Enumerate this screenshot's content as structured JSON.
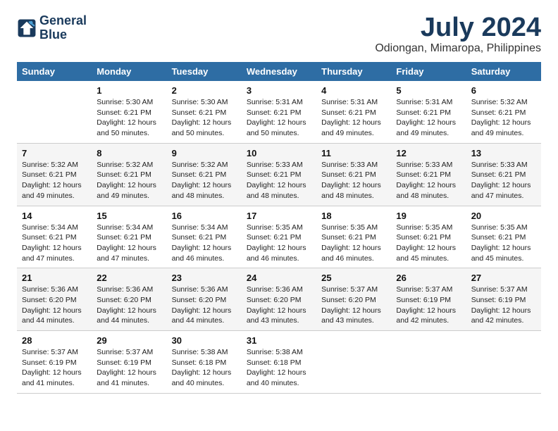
{
  "header": {
    "logo_line1": "General",
    "logo_line2": "Blue",
    "month": "July 2024",
    "location": "Odiongan, Mimaropa, Philippines"
  },
  "days_of_week": [
    "Sunday",
    "Monday",
    "Tuesday",
    "Wednesday",
    "Thursday",
    "Friday",
    "Saturday"
  ],
  "weeks": [
    [
      {
        "day": "",
        "sunrise": "",
        "sunset": "",
        "daylight": ""
      },
      {
        "day": "1",
        "sunrise": "Sunrise: 5:30 AM",
        "sunset": "Sunset: 6:21 PM",
        "daylight": "Daylight: 12 hours and 50 minutes."
      },
      {
        "day": "2",
        "sunrise": "Sunrise: 5:30 AM",
        "sunset": "Sunset: 6:21 PM",
        "daylight": "Daylight: 12 hours and 50 minutes."
      },
      {
        "day": "3",
        "sunrise": "Sunrise: 5:31 AM",
        "sunset": "Sunset: 6:21 PM",
        "daylight": "Daylight: 12 hours and 50 minutes."
      },
      {
        "day": "4",
        "sunrise": "Sunrise: 5:31 AM",
        "sunset": "Sunset: 6:21 PM",
        "daylight": "Daylight: 12 hours and 49 minutes."
      },
      {
        "day": "5",
        "sunrise": "Sunrise: 5:31 AM",
        "sunset": "Sunset: 6:21 PM",
        "daylight": "Daylight: 12 hours and 49 minutes."
      },
      {
        "day": "6",
        "sunrise": "Sunrise: 5:32 AM",
        "sunset": "Sunset: 6:21 PM",
        "daylight": "Daylight: 12 hours and 49 minutes."
      }
    ],
    [
      {
        "day": "7",
        "sunrise": "Sunrise: 5:32 AM",
        "sunset": "Sunset: 6:21 PM",
        "daylight": "Daylight: 12 hours and 49 minutes."
      },
      {
        "day": "8",
        "sunrise": "Sunrise: 5:32 AM",
        "sunset": "Sunset: 6:21 PM",
        "daylight": "Daylight: 12 hours and 49 minutes."
      },
      {
        "day": "9",
        "sunrise": "Sunrise: 5:32 AM",
        "sunset": "Sunset: 6:21 PM",
        "daylight": "Daylight: 12 hours and 48 minutes."
      },
      {
        "day": "10",
        "sunrise": "Sunrise: 5:33 AM",
        "sunset": "Sunset: 6:21 PM",
        "daylight": "Daylight: 12 hours and 48 minutes."
      },
      {
        "day": "11",
        "sunrise": "Sunrise: 5:33 AM",
        "sunset": "Sunset: 6:21 PM",
        "daylight": "Daylight: 12 hours and 48 minutes."
      },
      {
        "day": "12",
        "sunrise": "Sunrise: 5:33 AM",
        "sunset": "Sunset: 6:21 PM",
        "daylight": "Daylight: 12 hours and 48 minutes."
      },
      {
        "day": "13",
        "sunrise": "Sunrise: 5:33 AM",
        "sunset": "Sunset: 6:21 PM",
        "daylight": "Daylight: 12 hours and 47 minutes."
      }
    ],
    [
      {
        "day": "14",
        "sunrise": "Sunrise: 5:34 AM",
        "sunset": "Sunset: 6:21 PM",
        "daylight": "Daylight: 12 hours and 47 minutes."
      },
      {
        "day": "15",
        "sunrise": "Sunrise: 5:34 AM",
        "sunset": "Sunset: 6:21 PM",
        "daylight": "Daylight: 12 hours and 47 minutes."
      },
      {
        "day": "16",
        "sunrise": "Sunrise: 5:34 AM",
        "sunset": "Sunset: 6:21 PM",
        "daylight": "Daylight: 12 hours and 46 minutes."
      },
      {
        "day": "17",
        "sunrise": "Sunrise: 5:35 AM",
        "sunset": "Sunset: 6:21 PM",
        "daylight": "Daylight: 12 hours and 46 minutes."
      },
      {
        "day": "18",
        "sunrise": "Sunrise: 5:35 AM",
        "sunset": "Sunset: 6:21 PM",
        "daylight": "Daylight: 12 hours and 46 minutes."
      },
      {
        "day": "19",
        "sunrise": "Sunrise: 5:35 AM",
        "sunset": "Sunset: 6:21 PM",
        "daylight": "Daylight: 12 hours and 45 minutes."
      },
      {
        "day": "20",
        "sunrise": "Sunrise: 5:35 AM",
        "sunset": "Sunset: 6:21 PM",
        "daylight": "Daylight: 12 hours and 45 minutes."
      }
    ],
    [
      {
        "day": "21",
        "sunrise": "Sunrise: 5:36 AM",
        "sunset": "Sunset: 6:20 PM",
        "daylight": "Daylight: 12 hours and 44 minutes."
      },
      {
        "day": "22",
        "sunrise": "Sunrise: 5:36 AM",
        "sunset": "Sunset: 6:20 PM",
        "daylight": "Daylight: 12 hours and 44 minutes."
      },
      {
        "day": "23",
        "sunrise": "Sunrise: 5:36 AM",
        "sunset": "Sunset: 6:20 PM",
        "daylight": "Daylight: 12 hours and 44 minutes."
      },
      {
        "day": "24",
        "sunrise": "Sunrise: 5:36 AM",
        "sunset": "Sunset: 6:20 PM",
        "daylight": "Daylight: 12 hours and 43 minutes."
      },
      {
        "day": "25",
        "sunrise": "Sunrise: 5:37 AM",
        "sunset": "Sunset: 6:20 PM",
        "daylight": "Daylight: 12 hours and 43 minutes."
      },
      {
        "day": "26",
        "sunrise": "Sunrise: 5:37 AM",
        "sunset": "Sunset: 6:19 PM",
        "daylight": "Daylight: 12 hours and 42 minutes."
      },
      {
        "day": "27",
        "sunrise": "Sunrise: 5:37 AM",
        "sunset": "Sunset: 6:19 PM",
        "daylight": "Daylight: 12 hours and 42 minutes."
      }
    ],
    [
      {
        "day": "28",
        "sunrise": "Sunrise: 5:37 AM",
        "sunset": "Sunset: 6:19 PM",
        "daylight": "Daylight: 12 hours and 41 minutes."
      },
      {
        "day": "29",
        "sunrise": "Sunrise: 5:37 AM",
        "sunset": "Sunset: 6:19 PM",
        "daylight": "Daylight: 12 hours and 41 minutes."
      },
      {
        "day": "30",
        "sunrise": "Sunrise: 5:38 AM",
        "sunset": "Sunset: 6:18 PM",
        "daylight": "Daylight: 12 hours and 40 minutes."
      },
      {
        "day": "31",
        "sunrise": "Sunrise: 5:38 AM",
        "sunset": "Sunset: 6:18 PM",
        "daylight": "Daylight: 12 hours and 40 minutes."
      },
      {
        "day": "",
        "sunrise": "",
        "sunset": "",
        "daylight": ""
      },
      {
        "day": "",
        "sunrise": "",
        "sunset": "",
        "daylight": ""
      },
      {
        "day": "",
        "sunrise": "",
        "sunset": "",
        "daylight": ""
      }
    ]
  ]
}
